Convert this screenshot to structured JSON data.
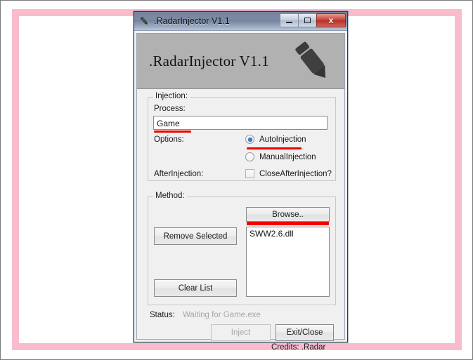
{
  "window": {
    "title": ".RadarInjector V1.1",
    "title_icon": "pencil-icon",
    "minimize_label": "minimize",
    "maximize_label": "maximize",
    "close_label": "x"
  },
  "banner": {
    "title": ".RadarInjector V1.1",
    "icon": "pencil-icon",
    "background_color": "#b1b1b1"
  },
  "injection_group": {
    "legend": "Injection:",
    "process_label": "Process:",
    "process_value": "Game",
    "process_placeholder": "",
    "options_label": "Options:",
    "radio_auto": "AutoInjection",
    "radio_manual": "ManualInjection",
    "after_injection_label": "AfterInjection:",
    "checkbox_close_after": "CloseAfterInjection?",
    "selected_option": "AutoInjection",
    "close_after_checked": false
  },
  "method_group": {
    "legend": "Method:",
    "browse_button": "Browse..",
    "remove_selected_button": "Remove Selected",
    "clear_list_button": "Clear List",
    "dll_items": [
      "SWW2.6.dll"
    ]
  },
  "footer": {
    "status_label": "Status:",
    "status_value": "Waiting for Game.exe",
    "inject_button": "Inject",
    "inject_enabled": false,
    "exit_button": "Exit/Close",
    "credits": "Credits: .Radar"
  },
  "annotations": {
    "color": "#f20000",
    "marks": [
      "process-value-underline",
      "auto-injection-underline",
      "browse-button-underline"
    ]
  },
  "frame": {
    "border_color": "#f9bccd"
  }
}
